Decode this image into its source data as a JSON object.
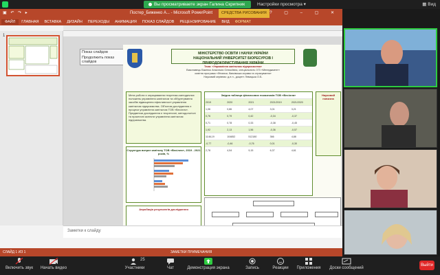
{
  "zoom_top": {
    "share_banner": "Вы просматриваете экран Галина Скрипник",
    "view_options": "Настройки просмотра",
    "view": "Вид"
  },
  "ppt": {
    "window_title": "Постер_Биженко А... - Microsoft PowerPoint",
    "context_tab": "СРЕДСТВА РИСОВАНИЯ",
    "ribbon_tabs": [
      "ФАЙЛ",
      "ГЛАВНАЯ",
      "ВСТАВКА",
      "ДИЗАЙН",
      "ПЕРЕХОДЫ",
      "АНИМАЦИЯ",
      "ПОКАЗ СЛАЙДОВ",
      "РЕЦЕНЗИРОВАНИЕ",
      "ВИД",
      "ФОРМАТ"
    ],
    "thumb_number": "1",
    "float_menu": [
      "Показ слайдов",
      "Продолжить показ слайдов"
    ],
    "notes_placeholder": "Заметки к слайду",
    "status_text": "СЛАЙД 1 ИЗ 1",
    "status_right": "ЗАМЕТКИ   ПРИМЕЧАНИЯ"
  },
  "slide": {
    "univ_line1": "МІНІСТЕРСТВО ОСВІТИ І НАУКИ УКРАЇНИ",
    "univ_line2": "НАЦІОНАЛЬНИЙ УНІВЕРСИТЕТ БІОРЕСУРСІВ І ПРИРОДОКОРИСТУВАННЯ УКРАЇНИ",
    "topic": "Тема: «Управління капіталом підприємства»",
    "author_line": "Виконавець Біженко Анастасія Олексіївна, спеціальність 073 «Менеджмент»",
    "program_line": "освітня програма «Фінанси, банківська справа та страхування»",
    "advisor_line": "Науковий керівник: д.е.н., доцент Левицька О.Б.",
    "left_panel": "Мета роботи є опрацювання теоретико-методичних положень управління капіталом та обґрунтування засобів підвищення ефективності управління капіталом підприємства. Об'єктом дослідження є процеси управління капіталом ТОВ «Весілля». Предметом дослідження є теоретичні, методологічні та практичні аспекти управління капіталом підприємства.",
    "table_title": "Звідна таблиця фінансових показників ТОВ «Весілля»",
    "table_rows": [
      [
        "2019",
        "2020",
        "2021",
        "2021/2019",
        "2021/2020"
      ],
      [
        "1,06",
        "0,86",
        "4,07",
        "3,01",
        "3,21"
      ],
      [
        "0,76",
        "0,79",
        "0,42",
        "-0,34",
        "-0,37"
      ],
      [
        "0,71",
        "0,78",
        "0,33",
        "-0,38",
        "-0,45"
      ],
      [
        "1,92",
        "2,13",
        "1,56",
        "-0,36",
        "-0,57"
      ],
      [
        "1146,19",
        "104852",
        "512180",
        "366",
        "4,88"
      ],
      [
        "-0,77",
        "-0,46",
        "-0,76",
        "0,01",
        "-0,30"
      ],
      [
        "2,78",
        "4,54",
        "9,15",
        "6,37",
        "4,61"
      ]
    ],
    "chart_title": "Структура витрат капіталу ТОВ «Весілля», 2019 - 2021 років, %",
    "refs_title": "Апробація результатів дослідження",
    "right_panel_title": "Науковий новизна"
  },
  "gallery": {
    "tiles": [
      {
        "name": ""
      },
      {
        "name": ""
      },
      {
        "name": ""
      },
      {
        "name": ""
      }
    ]
  },
  "controls": {
    "mute": "Включить звук",
    "video": "Начать видео",
    "participants": "Участники",
    "participants_count": "25",
    "chat": "Чат",
    "share": "Демонстрация экрана",
    "record": "Запись",
    "reactions": "Реакции",
    "apps": "Приложения",
    "whiteboard": "Доски сообщений",
    "end": "Выйти"
  }
}
